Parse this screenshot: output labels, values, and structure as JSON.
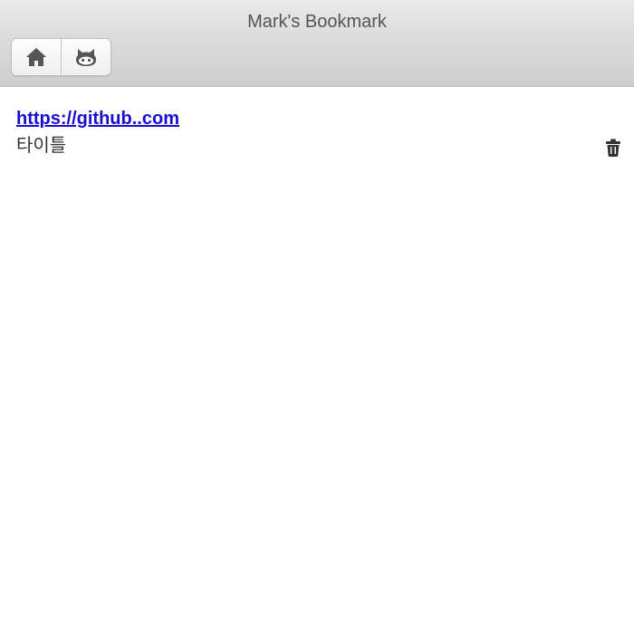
{
  "header": {
    "title": "Mark's Bookmark",
    "buttons": [
      {
        "icon": "home-icon"
      },
      {
        "icon": "github-icon"
      }
    ]
  },
  "bookmarks": [
    {
      "url": "https://github..com",
      "title": "타이틀",
      "delete_icon": "trash-icon"
    }
  ],
  "colors": {
    "link": "#1a0dcc",
    "text": "#333333",
    "header_text": "#555555",
    "icon": "#444444"
  }
}
